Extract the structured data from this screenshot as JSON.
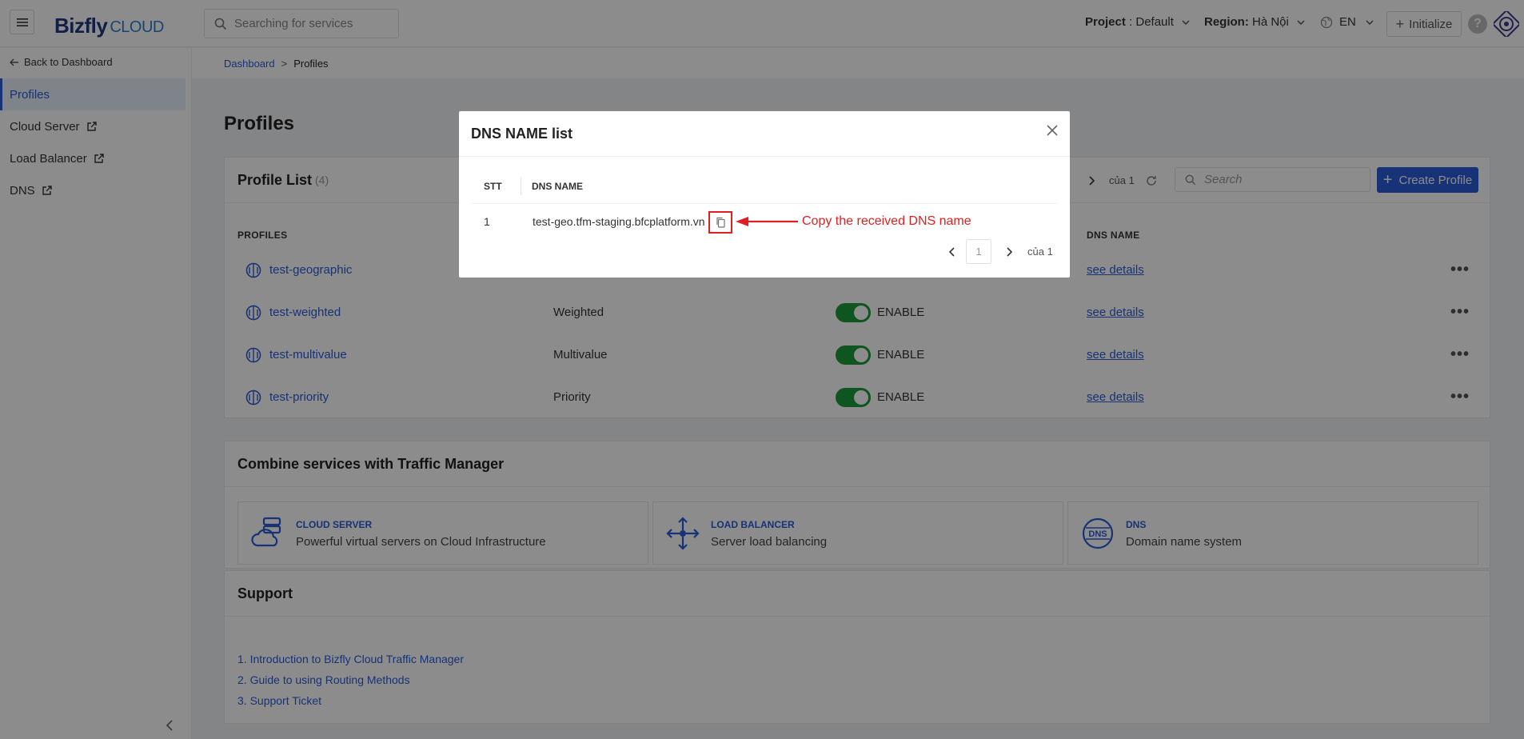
{
  "header": {
    "logo_main": "Bizfly",
    "logo_sub": "CLOUD",
    "search_placeholder": "Searching for services",
    "project_label": "Project",
    "project_value": ": Default",
    "region_label": "Region:",
    "region_value": "Hà Nội",
    "language": "EN",
    "initialize_label": "Initialize",
    "help": "?"
  },
  "sidebar": {
    "back_label": "Back to Dashboard",
    "items": [
      {
        "label": "Profiles"
      },
      {
        "label": "Cloud Server"
      },
      {
        "label": "Load Balancer"
      },
      {
        "label": "DNS"
      }
    ]
  },
  "breadcrumb": {
    "root": "Dashboard",
    "sep": ">",
    "current": "Profiles"
  },
  "page_title": "Profiles",
  "profile_list": {
    "title": "Profile List",
    "count": "(4)",
    "page_of": "của 1",
    "search_placeholder": "Search",
    "create_label": "Create Profile",
    "columns": {
      "profiles": "PROFILES",
      "dns_name": "DNS NAME"
    },
    "rows": [
      {
        "name": "test-geographic",
        "method": "",
        "status": "",
        "details": "see details"
      },
      {
        "name": "test-weighted",
        "method": "Weighted",
        "status": "ENABLE",
        "details": "see details"
      },
      {
        "name": "test-multivalue",
        "method": "Multivalue",
        "status": "ENABLE",
        "details": "see details"
      },
      {
        "name": "test-priority",
        "method": "Priority",
        "status": "ENABLE",
        "details": "see details"
      }
    ]
  },
  "combine": {
    "title": "Combine services with Traffic Manager",
    "services": [
      {
        "title": "CLOUD SERVER",
        "desc": "Powerful virtual servers on Cloud Infrastructure"
      },
      {
        "title": "LOAD BALANCER",
        "desc": "Server load balancing"
      },
      {
        "title": "DNS",
        "desc": "Domain name system"
      }
    ]
  },
  "support": {
    "title": "Support",
    "links": [
      "1. Introduction to Bizfly Cloud Traffic Manager",
      "2. Guide to using Routing Methods",
      "3. Support Ticket"
    ]
  },
  "modal": {
    "title": "DNS NAME list",
    "col_stt": "STT",
    "col_dns": "DNS NAME",
    "row_stt": "1",
    "row_dns": "test-geo.tfm-staging.bfcplatform.vn",
    "annotation": "Copy the received DNS name",
    "page": "1",
    "page_of": "của 1"
  },
  "colors": {
    "primary": "#2a5bd7",
    "enable": "#1c9b3a",
    "annotation": "#e02020"
  }
}
